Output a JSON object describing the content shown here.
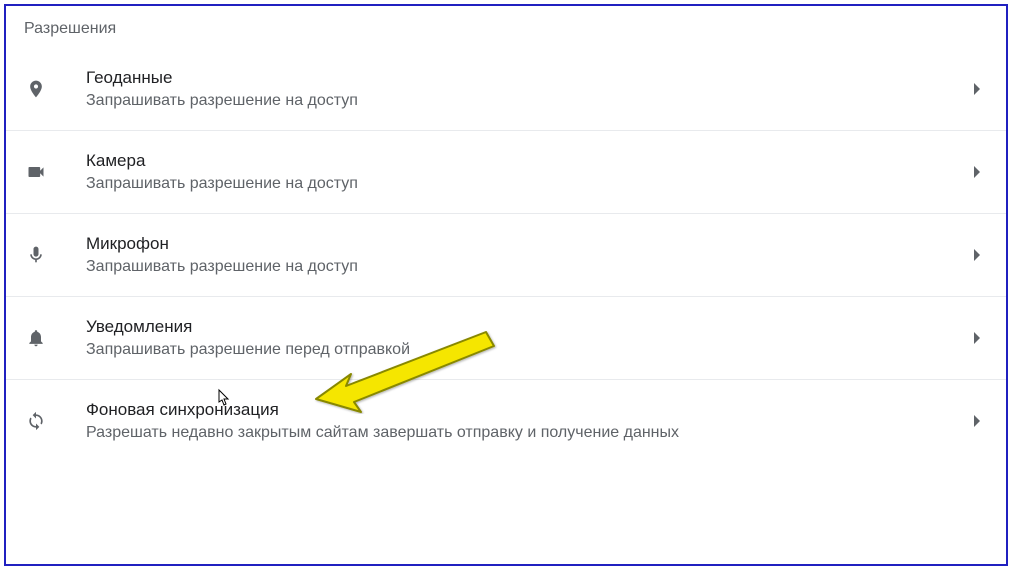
{
  "section": {
    "header": "Разрешения"
  },
  "items": [
    {
      "title": "Геоданные",
      "subtitle": "Запрашивать разрешение на доступ"
    },
    {
      "title": "Камера",
      "subtitle": "Запрашивать разрешение на доступ"
    },
    {
      "title": "Микрофон",
      "subtitle": "Запрашивать разрешение на доступ"
    },
    {
      "title": "Уведомления",
      "subtitle": "Запрашивать разрешение перед отправкой"
    },
    {
      "title": "Фоновая синхронизация",
      "subtitle": "Разрешать недавно закрытым сайтам завершать отправку и получение данных"
    }
  ]
}
